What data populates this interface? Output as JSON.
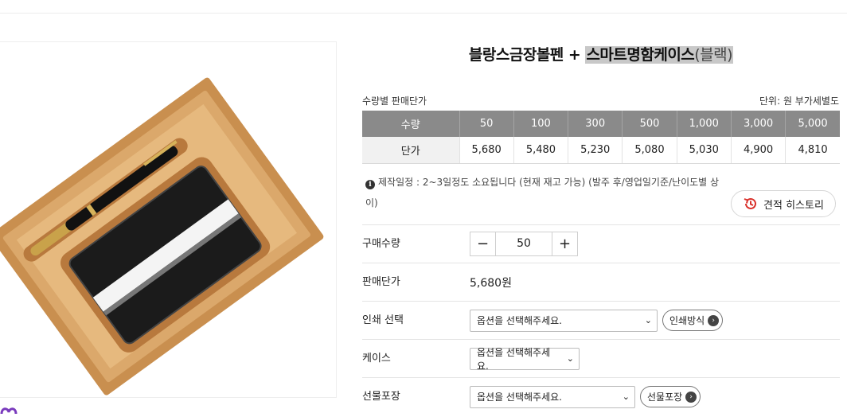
{
  "product": {
    "title_main": "블랑스금장볼펜 + ",
    "title_highlight": "스마트명함케이스",
    "title_sub": "(블랙)"
  },
  "price_table": {
    "caption": "수량별 판매단가",
    "unit_note": "단위: 원 부가세별도",
    "header_label": "수량",
    "row_label": "단가",
    "quantities": [
      "50",
      "100",
      "300",
      "500",
      "1,000",
      "3,000",
      "5,000"
    ],
    "prices": [
      "5,680",
      "5,480",
      "5,230",
      "5,080",
      "5,030",
      "4,900",
      "4,810"
    ]
  },
  "notice": {
    "info_glyph": "i",
    "text": "제작일정 : 2~3일정도 소요됩니다 (현재 재고 가능) (발주 후/영업일기준/난이도별 상이)"
  },
  "history_button": {
    "label": "견적 히스토리",
    "icon": "history-icon",
    "color": "#d9302a"
  },
  "order": {
    "quantity": {
      "label": "구매수량",
      "value": "50",
      "minus": "−",
      "plus": "+"
    },
    "unit_price": {
      "label": "판매단가",
      "value": "5,680원"
    },
    "print": {
      "label": "인쇄 선택",
      "selected": "옵션을 선택해주세요.",
      "button": "인쇄방식"
    },
    "case": {
      "label": "케이스",
      "selected": "옵션을 선택해주세요."
    },
    "gift": {
      "label": "선물포장",
      "selected": "옵션을 선택해주세요.",
      "button": "선물포장"
    }
  },
  "colors": {
    "table_header": "#8a8a8a",
    "box_kraft": "#d9a86a",
    "highlight": "#c8c8c8"
  }
}
